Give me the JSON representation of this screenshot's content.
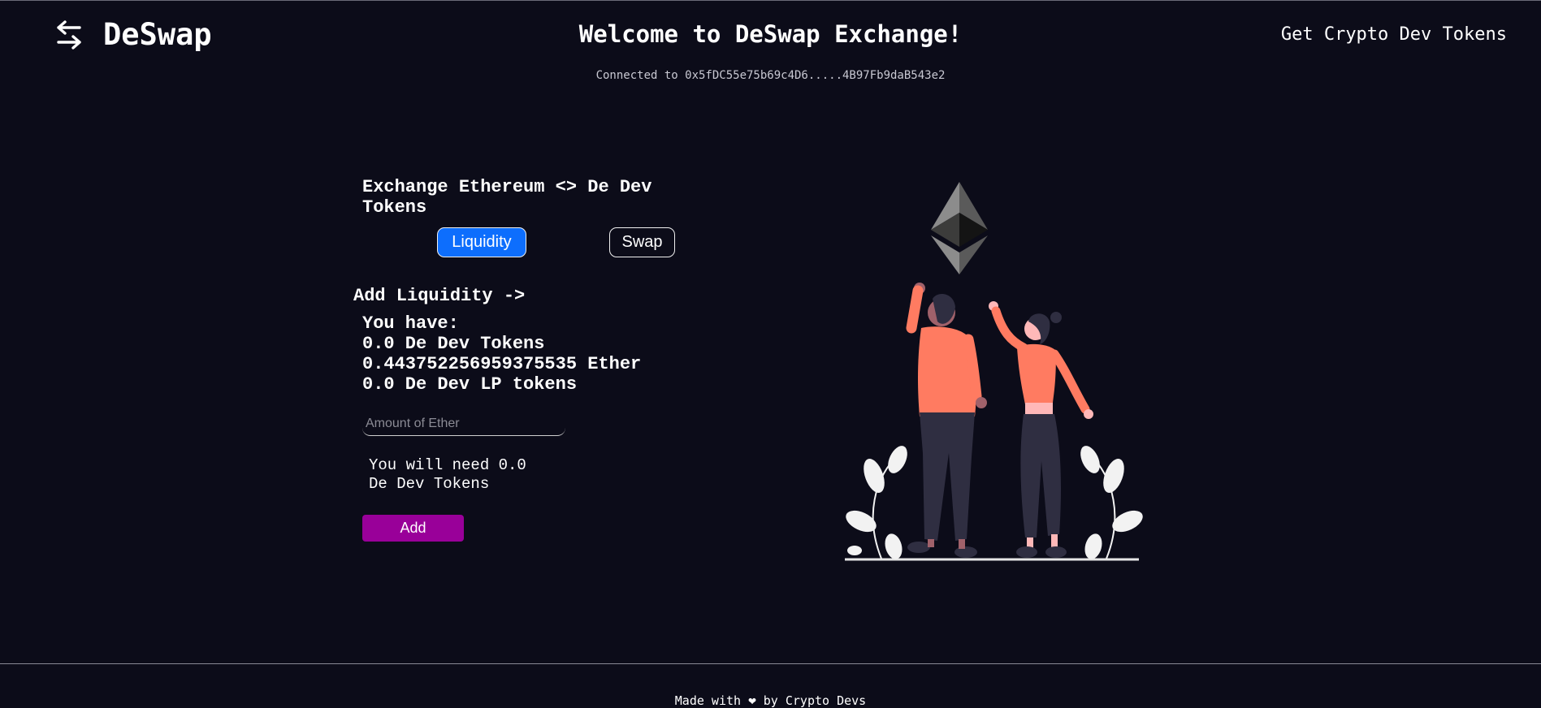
{
  "header": {
    "brand": "DeSwap",
    "welcome": "Welcome to DeSwap Exchange!",
    "get_tokens": "Get Crypto Dev Tokens",
    "connected": "Connected to 0x5fDC55e75b69c4D6.....4B97Fb9daB543e2",
    "brand_icon": "swap-arrows-icon"
  },
  "exchange": {
    "title": "Exchange Ethereum <> De Dev Tokens",
    "tabs": [
      {
        "label": "Liquidity",
        "active": true
      },
      {
        "label": "Swap",
        "active": false
      }
    ],
    "section_heading": "Add Liquidity ->",
    "balances": {
      "heading": "You have:",
      "tokens": "0.0 De Dev Tokens",
      "ether": "0.443752256959375535 Ether",
      "lp": "0.0 De Dev LP tokens"
    },
    "ether_input": {
      "value": "",
      "placeholder": "Amount of Ether"
    },
    "need_text": "You will need 0.0 De Dev Tokens",
    "add_label": "Add"
  },
  "illustration": {
    "name": "people-cheering-ethereum-illustration"
  },
  "footer": {
    "prefix": "Made with",
    "heart_icon": "heart-icon",
    "heart": "❤",
    "suffix": "by Crypto Devs"
  },
  "colors": {
    "background": "#0c0c19",
    "active_tab": "#0d6efd",
    "add_button": "#990099",
    "figure_shirt": "#ff7b61",
    "figure_pants": "#2f2e41"
  }
}
